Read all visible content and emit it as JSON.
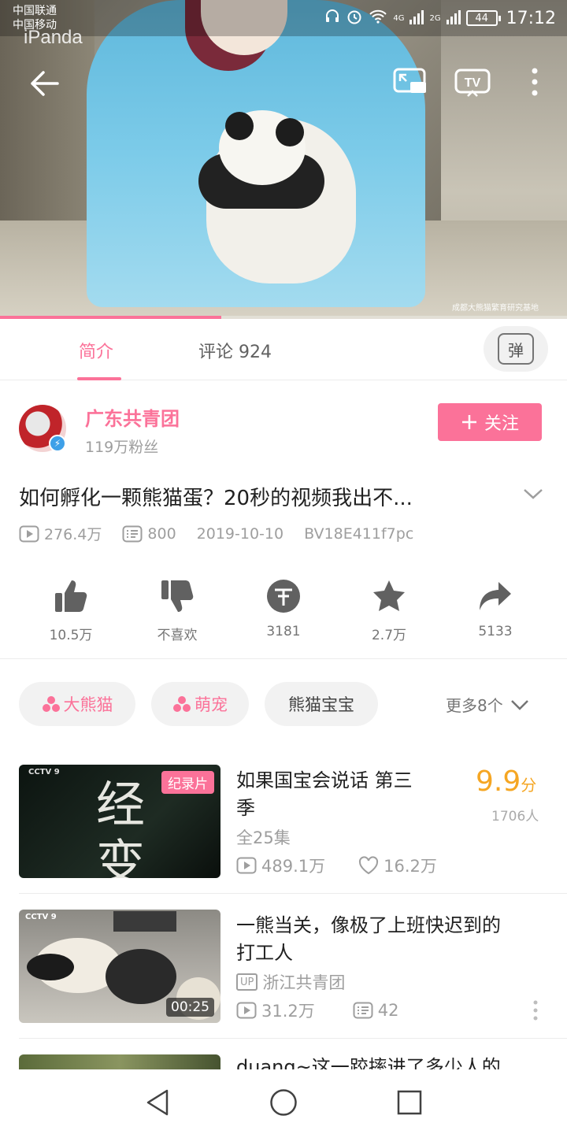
{
  "status": {
    "carrier1": "中国联通",
    "carrier2": "中国移动",
    "net1": "4G",
    "net2": "2G",
    "battery": "44",
    "time": "17:12"
  },
  "player": {
    "logo": "iPanda",
    "watermark": "成都大熊猫繁育研究基地",
    "progress": 0.39
  },
  "tabs": {
    "intro": "简介",
    "comments": "评论 924",
    "danmu": "弹"
  },
  "uploader": {
    "name": "广东共青团",
    "fans": "119万粉丝",
    "follow_label": "关注"
  },
  "video": {
    "title": "如何孵化一颗熊猫蛋？20秒的视频我出不...",
    "views": "276.4万",
    "danmaku": "800",
    "date": "2019-10-10",
    "bvid": "BV18E411f7pc"
  },
  "actions": {
    "like": "10.5万",
    "dislike": "不喜欢",
    "coin": "3181",
    "favorite": "2.7万",
    "share": "5133"
  },
  "tags": {
    "t1": "大熊猫",
    "t2": "萌宠",
    "t3": "熊猫宝宝",
    "more": "更多8个"
  },
  "related": [
    {
      "title_line1": "如果国宝会说话 第三",
      "title_line2": "季",
      "episodes": "全25集",
      "views": "489.1万",
      "likes": "16.2万",
      "score": "9.9",
      "score_unit": "分",
      "raters": "1706人",
      "badge": "纪录片",
      "thumb_text1": "经",
      "thumb_text2": "变",
      "thumb_logo": "CCTV 9"
    },
    {
      "title_line1": "一熊当关，像极了上班快迟到的",
      "title_line2": "打工人",
      "up_tag": "UP",
      "uploader": "浙江共青团",
      "views": "31.2万",
      "danmaku": "42",
      "duration": "00:25",
      "thumb_logo": "CCTV 9"
    },
    {
      "title_line1": "duang~这一跤摔进了多少人的"
    }
  ],
  "colors": {
    "accent": "#fb7299",
    "score": "#f5a623"
  }
}
